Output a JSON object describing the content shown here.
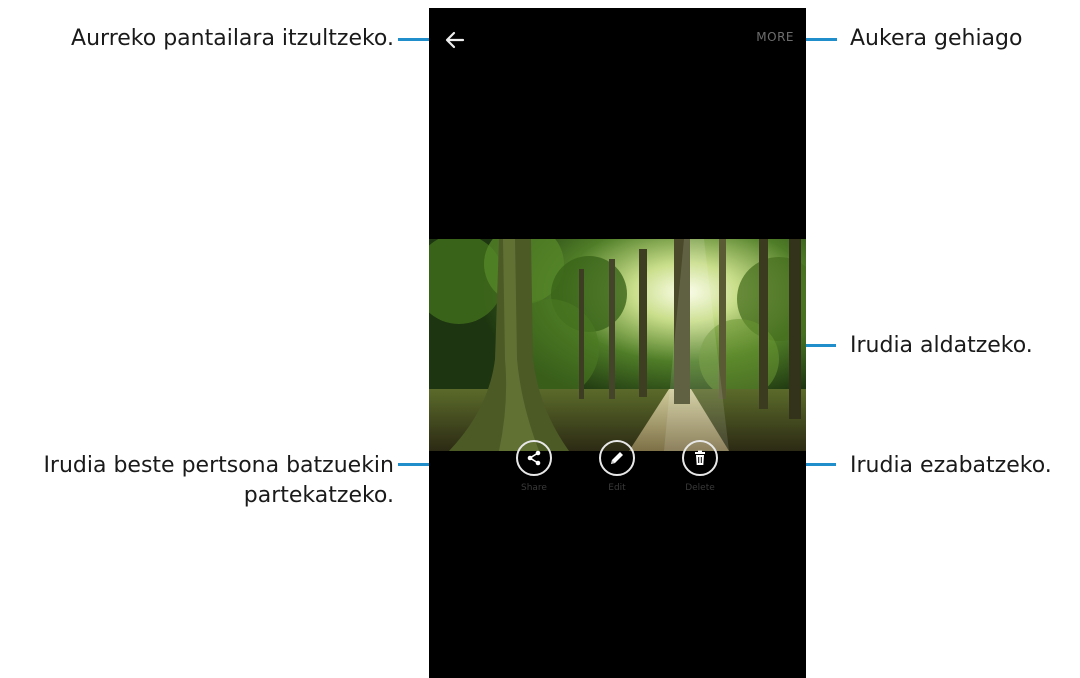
{
  "annotations": {
    "back": "Aurreko pantailara itzultzeko.",
    "more": "Aukera gehiago",
    "edit": "Irudia aldatzeko.",
    "share_line1": "Irudia beste pertsona batzuekin",
    "share_line2": "partekatzeko.",
    "delete": "Irudia ezabatzeko."
  },
  "screen": {
    "more_label": "MORE",
    "actions": [
      {
        "icon": "share-icon",
        "label": "Share"
      },
      {
        "icon": "pencil-icon",
        "label": "Edit"
      },
      {
        "icon": "trash-icon",
        "label": "Delete"
      }
    ]
  },
  "colors": {
    "leader_line": "#1f8ecb",
    "screen_bg": "#000000"
  }
}
